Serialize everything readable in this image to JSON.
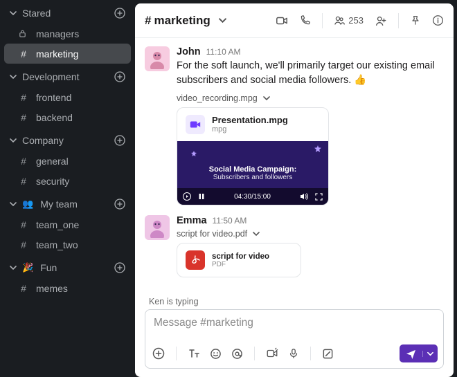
{
  "sidebar": {
    "sections": [
      {
        "title": "Stared",
        "has_plus": true,
        "emoji": "",
        "items": [
          {
            "icon": "lock",
            "label": "managers"
          },
          {
            "icon": "hash",
            "label": "marketing",
            "active": true
          }
        ]
      },
      {
        "title": "Development",
        "has_plus": true,
        "emoji": "",
        "items": [
          {
            "icon": "hash",
            "label": "frontend"
          },
          {
            "icon": "hash",
            "label": "backend"
          }
        ]
      },
      {
        "title": "Company",
        "has_plus": true,
        "emoji": "",
        "items": [
          {
            "icon": "hash",
            "label": "general"
          },
          {
            "icon": "hash",
            "label": "security"
          }
        ]
      },
      {
        "title": "My team",
        "has_plus": true,
        "emoji": "👥",
        "items": [
          {
            "icon": "hash",
            "label": "team_one"
          },
          {
            "icon": "hash",
            "label": "team_two"
          }
        ]
      },
      {
        "title": "Fun",
        "has_plus": true,
        "emoji": "🎉",
        "items": [
          {
            "icon": "hash",
            "label": "memes"
          }
        ]
      }
    ]
  },
  "header": {
    "channel_name": "marketing",
    "member_count": "253"
  },
  "messages": [
    {
      "author": "John",
      "time": "11:10 AM",
      "text": "For the soft launch, we'll primarily target our existing email subscribers and social media followers. 👍",
      "file_label": "video_recording.mpg",
      "attachment": {
        "title": "Presentation.mpg",
        "type_label": "mpg",
        "video_title": "Social Media Campaign:",
        "video_sub": "Subscribers and followers",
        "elapsed": "04:30",
        "duration": "15:00"
      }
    },
    {
      "author": "Emma",
      "time": "11:50 AM",
      "file_label": "script for video.pdf",
      "pdf": {
        "title": "script for video",
        "type_label": "PDF"
      }
    }
  ],
  "typing_status": "Ken is typing",
  "composer": {
    "placeholder": "Message #marketing"
  }
}
